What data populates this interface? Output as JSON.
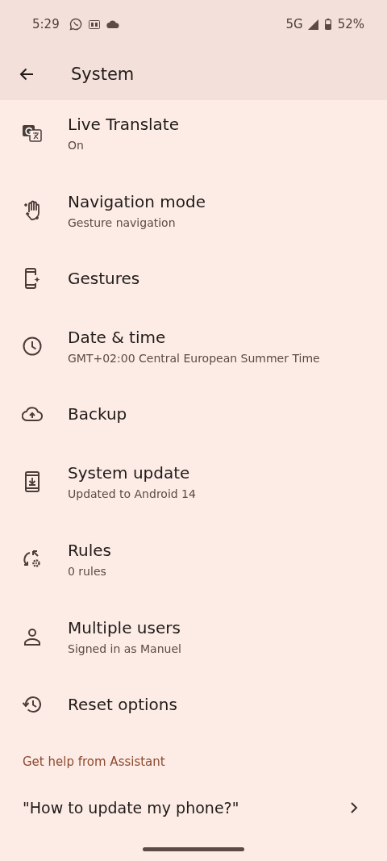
{
  "status_bar": {
    "time": "5:29",
    "network": "5G",
    "battery": "52%"
  },
  "app_bar": {
    "title": "System"
  },
  "items": [
    {
      "title": "Live Translate",
      "summary": "On"
    },
    {
      "title": "Navigation mode",
      "summary": "Gesture navigation"
    },
    {
      "title": "Gestures"
    },
    {
      "title": "Date & time",
      "summary": "GMT+02:00 Central European Summer Time"
    },
    {
      "title": "Backup"
    },
    {
      "title": "System update",
      "summary": "Updated to Android 14"
    },
    {
      "title": "Rules",
      "summary": "0 rules"
    },
    {
      "title": "Multiple users",
      "summary": "Signed in as Manuel"
    },
    {
      "title": "Reset options"
    }
  ],
  "help_section": {
    "header": "Get help from Assistant",
    "suggestion": "\"How to update my phone?\""
  }
}
